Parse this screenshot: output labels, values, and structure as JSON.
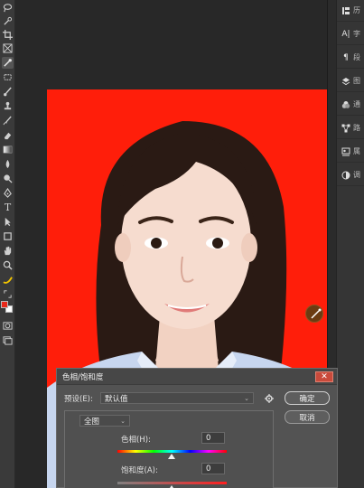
{
  "toolbar": {
    "tools": [
      "lasso-tool",
      "crop-tool",
      "frame-tool",
      "eyedropper-tool",
      "patch-tool",
      "brush-tool",
      "stamp-tool",
      "history-brush-tool",
      "eraser-tool",
      "gradient-tool",
      "blur-tool",
      "dodge-tool",
      "pen-tool",
      "type-tool",
      "path-select-tool",
      "rectangle-tool",
      "hand-tool",
      "zoom-tool",
      "more-tools"
    ],
    "type_glyph": "T",
    "foreground_color": "#e8291b",
    "background_color": "#ffffff"
  },
  "right_panel": {
    "items": [
      {
        "icon": "history-icon",
        "label": "历"
      },
      {
        "icon": "character-icon",
        "glyph": "A|",
        "label": "字"
      },
      {
        "icon": "paragraph-icon",
        "glyph": "¶",
        "label": "段"
      },
      {
        "icon": "layers-icon",
        "label": "图"
      },
      {
        "icon": "channels-icon",
        "label": "通"
      },
      {
        "icon": "paths-icon",
        "label": "路"
      },
      {
        "icon": "properties-icon",
        "label": "属"
      },
      {
        "icon": "adjustments-icon",
        "label": "调"
      }
    ]
  },
  "canvas": {
    "background_color": "#ff1e0a"
  },
  "dialog": {
    "title": "色相/饱和度",
    "close_glyph": "✕",
    "preset_label": "预设(E):",
    "preset_value": "默认值",
    "ok_label": "确定",
    "cancel_label": "取消",
    "channel_value": "全图",
    "hue_label": "色相(H):",
    "hue_value": "0",
    "saturation_label": "饱和度(A):",
    "saturation_value": "0"
  }
}
